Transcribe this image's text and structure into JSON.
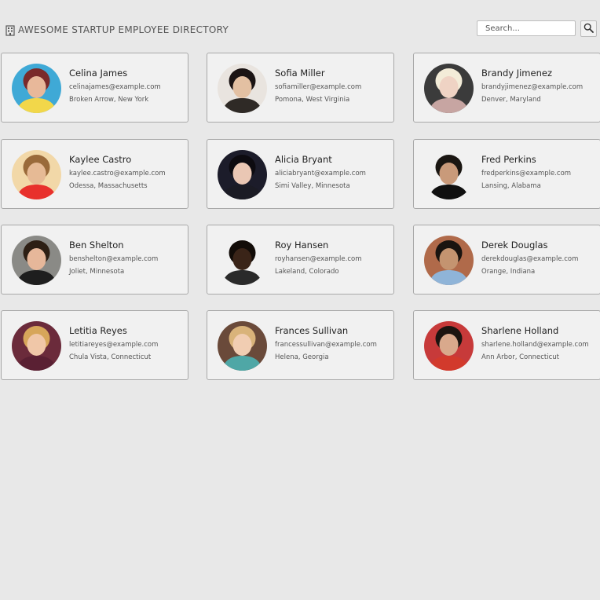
{
  "header": {
    "title": "Awesome Startup Employee Directory",
    "icon": "building-icon",
    "search_placeholder": "Search...",
    "search_button_icon": "magnifier-icon"
  },
  "employees": [
    {
      "name": "Celina James",
      "email": "celinajames@example.com",
      "location": "Broken Arrow, New York",
      "bg": "#3fa9d6",
      "skin": "#e8b89a",
      "hair": "#7a2a2a",
      "shirt": "#f2d74a"
    },
    {
      "name": "Sofia Miller",
      "email": "sofiamiller@example.com",
      "location": "Pomona, West Virginia",
      "bg": "#e9e4df",
      "skin": "#e3c0a2",
      "hair": "#1b1414",
      "shirt": "#2f2a26"
    },
    {
      "name": "Brandy Jimenez",
      "email": "brandyjimenez@example.com",
      "location": "Denver, Maryland",
      "bg": "#3b3b3b",
      "skin": "#efd3c4",
      "hair": "#f3ecd8",
      "shirt": "#c7a5a2"
    },
    {
      "name": "Kaylee Castro",
      "email": "kaylee.castro@example.com",
      "location": "Odessa, Massachusetts",
      "bg": "#f2d8a8",
      "skin": "#e6ba95",
      "hair": "#9a6a3a",
      "shirt": "#e8302c"
    },
    {
      "name": "Alicia Bryant",
      "email": "aliciabryant@example.com",
      "location": "Simi Valley, Minnesota",
      "bg": "#1c1c2a",
      "skin": "#eac7b4",
      "hair": "#0d0b10",
      "shirt": "#1b1b24"
    },
    {
      "name": "Fred Perkins",
      "email": "fredperkins@example.com",
      "location": "Lansing, Alabama",
      "bg": "#f1f1f1",
      "skin": "#c99a7a",
      "hair": "#1a1612",
      "shirt": "#101010"
    },
    {
      "name": "Ben Shelton",
      "email": "benshelton@example.com",
      "location": "Joliet, Minnesota",
      "bg": "#8a8a86",
      "skin": "#e6b79a",
      "hair": "#2d1f14",
      "shirt": "#1e1e1e"
    },
    {
      "name": "Roy Hansen",
      "email": "royhansen@example.com",
      "location": "Lakeland, Colorado",
      "bg": "#f1f1f1",
      "skin": "#3a2418",
      "hair": "#120c08",
      "shirt": "#2a2a2a"
    },
    {
      "name": "Derek Douglas",
      "email": "derekdouglas@example.com",
      "location": "Orange, Indiana",
      "bg": "#b06a4a",
      "skin": "#c49470",
      "hair": "#1a1410",
      "shirt": "#8fb4d8"
    },
    {
      "name": "Letitia Reyes",
      "email": "letitiareyes@example.com",
      "location": "Chula Vista, Connecticut",
      "bg": "#6b2b3b",
      "skin": "#f0c7a8",
      "hair": "#d7a65a",
      "shirt": "#5a2033"
    },
    {
      "name": "Frances Sullivan",
      "email": "francessullivan@example.com",
      "location": "Helena, Georgia",
      "bg": "#6a4a3a",
      "skin": "#f1cdb2",
      "hair": "#d9b37a",
      "shirt": "#4fa7a6"
    },
    {
      "name": "Sharlene Holland",
      "email": "sharlene.holland@example.com",
      "location": "Ann Arbor, Connecticut",
      "bg": "#c73a3a",
      "skin": "#d9a98c",
      "hair": "#1c1410",
      "shirt": "#d23a2c"
    }
  ]
}
